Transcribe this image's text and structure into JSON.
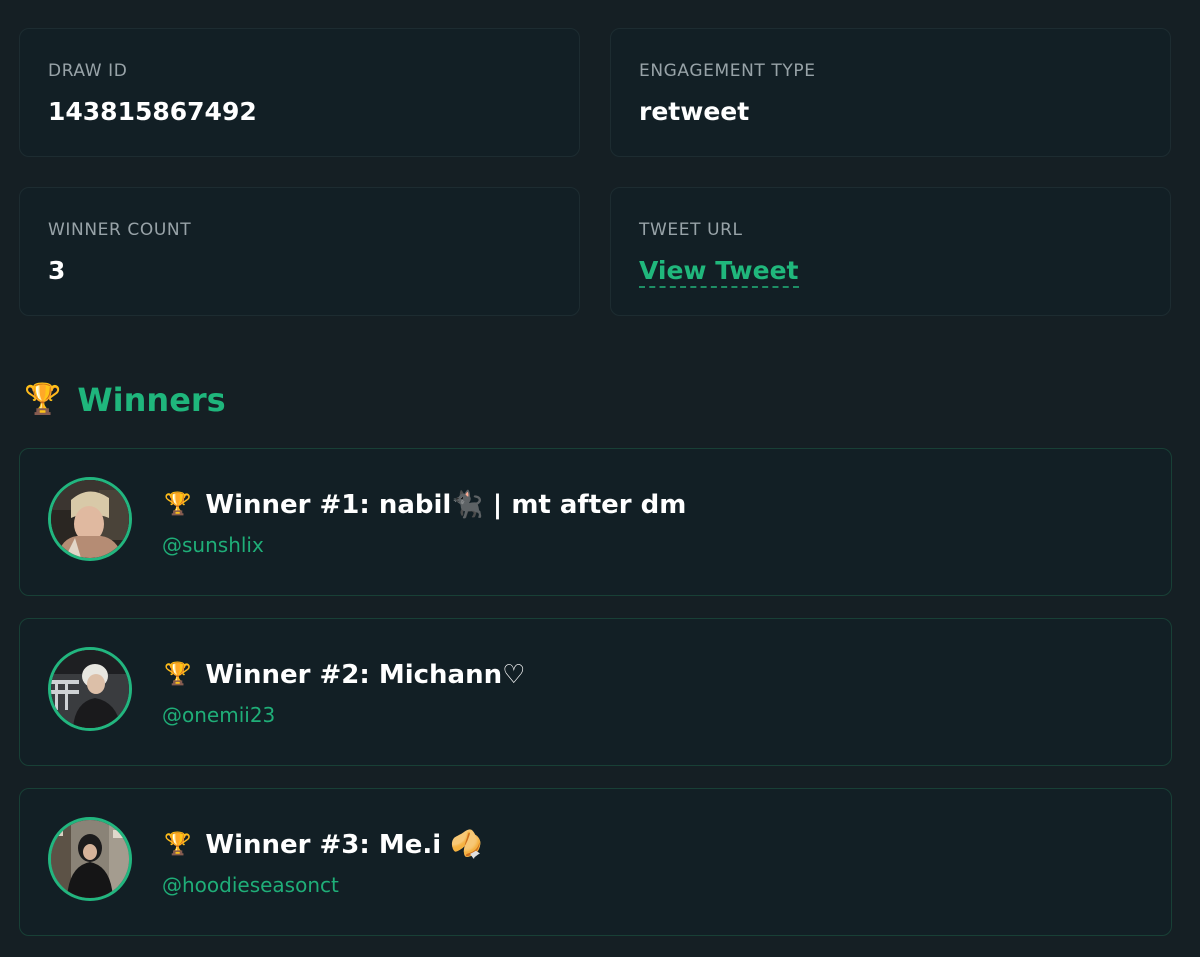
{
  "info": {
    "draw_id": {
      "label": "DRAW ID",
      "value": "143815867492"
    },
    "engagement_type": {
      "label": "ENGAGEMENT TYPE",
      "value": "retweet"
    },
    "winner_count": {
      "label": "WINNER COUNT",
      "value": "3"
    },
    "tweet_url": {
      "label": "TWEET URL",
      "link_text": "View Tweet"
    }
  },
  "winners_section": {
    "icon": "trophy-icon",
    "icon_glyph": "🏆",
    "title": "Winners"
  },
  "winners": [
    {
      "trophy": "🏆",
      "name": "Winner #1: nabil🐈‍⬛ | mt after dm",
      "handle": "@sunshlix",
      "avatar_icon": "avatar-photo"
    },
    {
      "trophy": "🏆",
      "name": "Winner #2: Michann♡",
      "handle": "@onemii23",
      "avatar_icon": "avatar-photo"
    },
    {
      "trophy": "🏆",
      "name": "Winner #3: Me.i 🥠",
      "handle": "@hoodieseasonct",
      "avatar_icon": "avatar-photo"
    }
  ],
  "colors": {
    "background": "#151f24",
    "card": "#121f25",
    "accent": "#1fb67c",
    "label": "#98a3a8"
  }
}
